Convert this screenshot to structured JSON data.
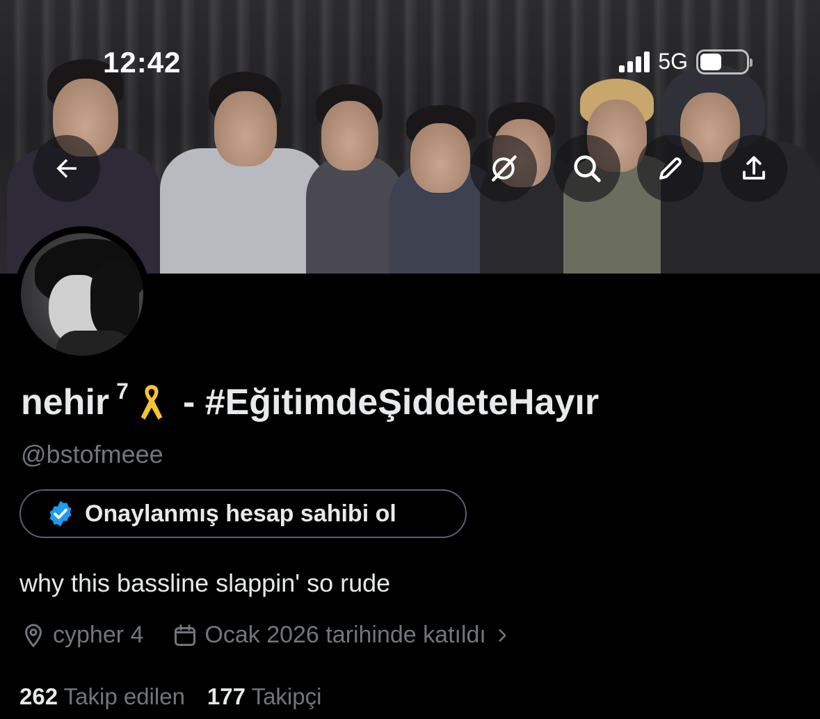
{
  "status_bar": {
    "time": "12:42",
    "network": "5G"
  },
  "banner": {
    "back_icon": "arrow-left-icon",
    "actions": [
      "grok-icon",
      "search-icon",
      "pencil-icon",
      "share-icon"
    ]
  },
  "profile": {
    "display_name": "nehir",
    "name_superscript": "7",
    "name_emoji": "🎗",
    "name_suffix": "- #EğitimdeŞiddeteHayır",
    "handle": "@bstofmeee",
    "verify_cta": "Onaylanmış hesap sahibi ol",
    "bio": "why this bassline slappin' so rude",
    "location": "cypher 4",
    "joined": "Ocak 2026 tarihinde katıldı",
    "following_count": "262",
    "following_label": "Takip edilen",
    "followers_count": "177",
    "followers_label": "Takipçi"
  },
  "colors": {
    "background": "#000000",
    "text": "#e7e9ea",
    "muted": "#71767b",
    "verified_blue": "#1d9bf0",
    "ribbon_gold": "#f4c430"
  }
}
